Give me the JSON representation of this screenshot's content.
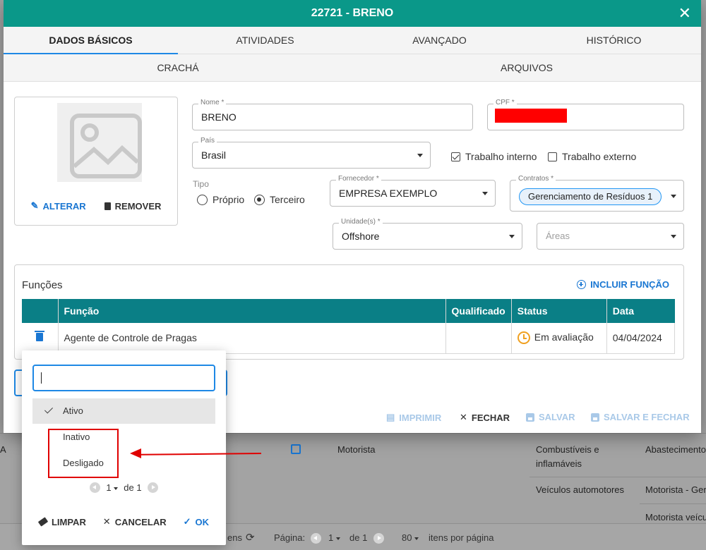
{
  "background": {
    "rows": [
      {
        "col_a": "A",
        "col_b": "Motorista",
        "col_c_line1": "Combustíveis e",
        "col_c_line2": "inflamáveis",
        "col_d": "Abastecimento"
      },
      {
        "col_c": "Veículos automotores",
        "col_d": "Motorista - Ger"
      },
      {
        "col_d": "Motorista veícu"
      }
    ],
    "footer": {
      "items_label": "ens",
      "page_label": "Página:",
      "page_value": "1",
      "of_label": "de 1",
      "per_page_value": "80",
      "per_page_label": "itens por página"
    }
  },
  "dialog": {
    "title": "22721 - BRENO",
    "close_icon": "close-icon",
    "tabs_row1": [
      "DADOS BÁSICOS",
      "ATIVIDADES",
      "AVANÇADO",
      "HISTÓRICO"
    ],
    "tabs_row2": [
      "CRACHÁ",
      "ARQUIVOS"
    ],
    "photo": {
      "change_label": "ALTERAR",
      "remove_label": "REMOVER"
    },
    "fields": {
      "nome_label": "Nome *",
      "nome_value": "BRENO",
      "cpf_label": "CPF *",
      "pais_label": "País",
      "pais_value": "Brasil",
      "trabalho_interno": "Trabalho interno",
      "trabalho_interno_checked": true,
      "trabalho_externo": "Trabalho externo",
      "trabalho_externo_checked": false,
      "tipo_label": "Tipo",
      "tipo_options": [
        "Próprio",
        "Terceiro"
      ],
      "tipo_selected": "Terceiro",
      "fornecedor_label": "Fornecedor *",
      "fornecedor_value": "EMPRESA EXEMPLO",
      "contratos_label": "Contratos *",
      "contratos_chip": "Gerenciamento de Resíduos 1",
      "unidades_label": "Unidade(s) *",
      "unidades_value": "Offshore",
      "areas_placeholder": "Áreas"
    },
    "funcoes": {
      "title": "Funções",
      "add_label": "INCLUIR FUNÇÃO",
      "columns": [
        "",
        "Função",
        "Qualificado",
        "Status",
        "Data"
      ],
      "rows": [
        {
          "funcao": "Agente de Controle de Pragas",
          "qualificado": "",
          "status": "Em avaliação",
          "data": "04/04/2024"
        }
      ]
    },
    "footer_buttons": {
      "print": "IMPRIMIR",
      "close": "FECHAR",
      "save": "SALVAR",
      "save_close": "SALVAR E FECHAR"
    }
  },
  "popup": {
    "search_value": "",
    "options": [
      {
        "label": "Ativo",
        "selected": true
      },
      {
        "label": "Inativo",
        "selected": false
      },
      {
        "label": "Desligado",
        "selected": false
      }
    ],
    "pager": {
      "page": "1",
      "of": "de 1"
    },
    "actions": {
      "clear": "LIMPAR",
      "cancel": "CANCELAR",
      "ok": "OK"
    }
  },
  "colors": {
    "header": "#0a9889",
    "table_header": "#0a7f86",
    "accent_blue": "#1976d2",
    "annotation_red": "#e00000",
    "status_orange": "#f0a020"
  }
}
